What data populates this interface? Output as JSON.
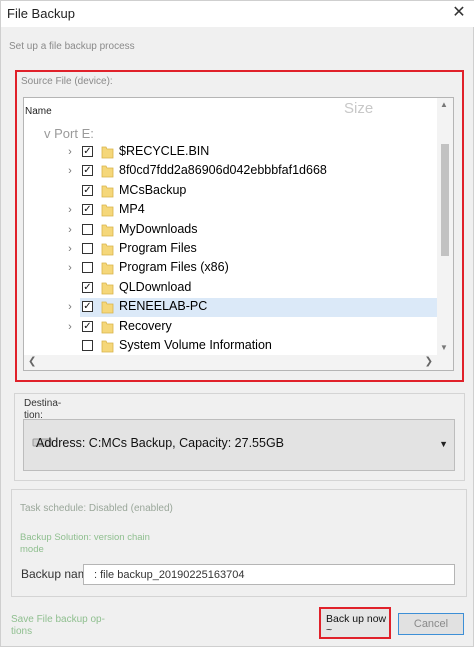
{
  "window": {
    "title": "File Backup",
    "subtitle": "Set up a file backup process"
  },
  "source": {
    "label": "Source File (device):",
    "columns": {
      "name": "Name",
      "size": "Size"
    },
    "root_node": "v Port E:",
    "items": [
      {
        "label": "$RECYCLE.BIN",
        "checked": true,
        "expandable": true,
        "selected": false
      },
      {
        "label": "8f0cd7fdd2a86906d042ebbbfaf1d668",
        "checked": true,
        "expandable": true,
        "selected": false
      },
      {
        "label": "MCsBackup",
        "checked": true,
        "expandable": false,
        "selected": false
      },
      {
        "label": "MP4",
        "checked": true,
        "expandable": true,
        "selected": false
      },
      {
        "label": "MyDownloads",
        "checked": false,
        "expandable": true,
        "selected": false
      },
      {
        "label": "Program Files",
        "checked": false,
        "expandable": true,
        "selected": false
      },
      {
        "label": "Program Files (x86)",
        "checked": false,
        "expandable": true,
        "selected": false
      },
      {
        "label": "QLDownload",
        "checked": true,
        "expandable": false,
        "selected": false
      },
      {
        "label": "RENEELAB-PC",
        "checked": true,
        "expandable": true,
        "selected": true
      },
      {
        "label": "Recovery",
        "checked": true,
        "expandable": true,
        "selected": false
      },
      {
        "label": "System Volume Information",
        "checked": false,
        "expandable": false,
        "selected": false
      }
    ]
  },
  "destination": {
    "label": "Destina-tion:",
    "value": "Address: C:MCs Backup, Capacity: 27.55GB"
  },
  "task": {
    "schedule": "Task schedule: Disabled (enabled)",
    "solution": "Backup Solution: version chain mode",
    "backup_name_label": "Backup name",
    "backup_name_value": ": file backup_20190225163704"
  },
  "footer": {
    "save_options": "Save File backup op-tions",
    "backup_now": "Back up now ~",
    "cancel": "Cancel"
  },
  "colors": {
    "highlight": "#e0212a",
    "folder": "#f5d77a",
    "selected_row": "#dbe9f8"
  }
}
